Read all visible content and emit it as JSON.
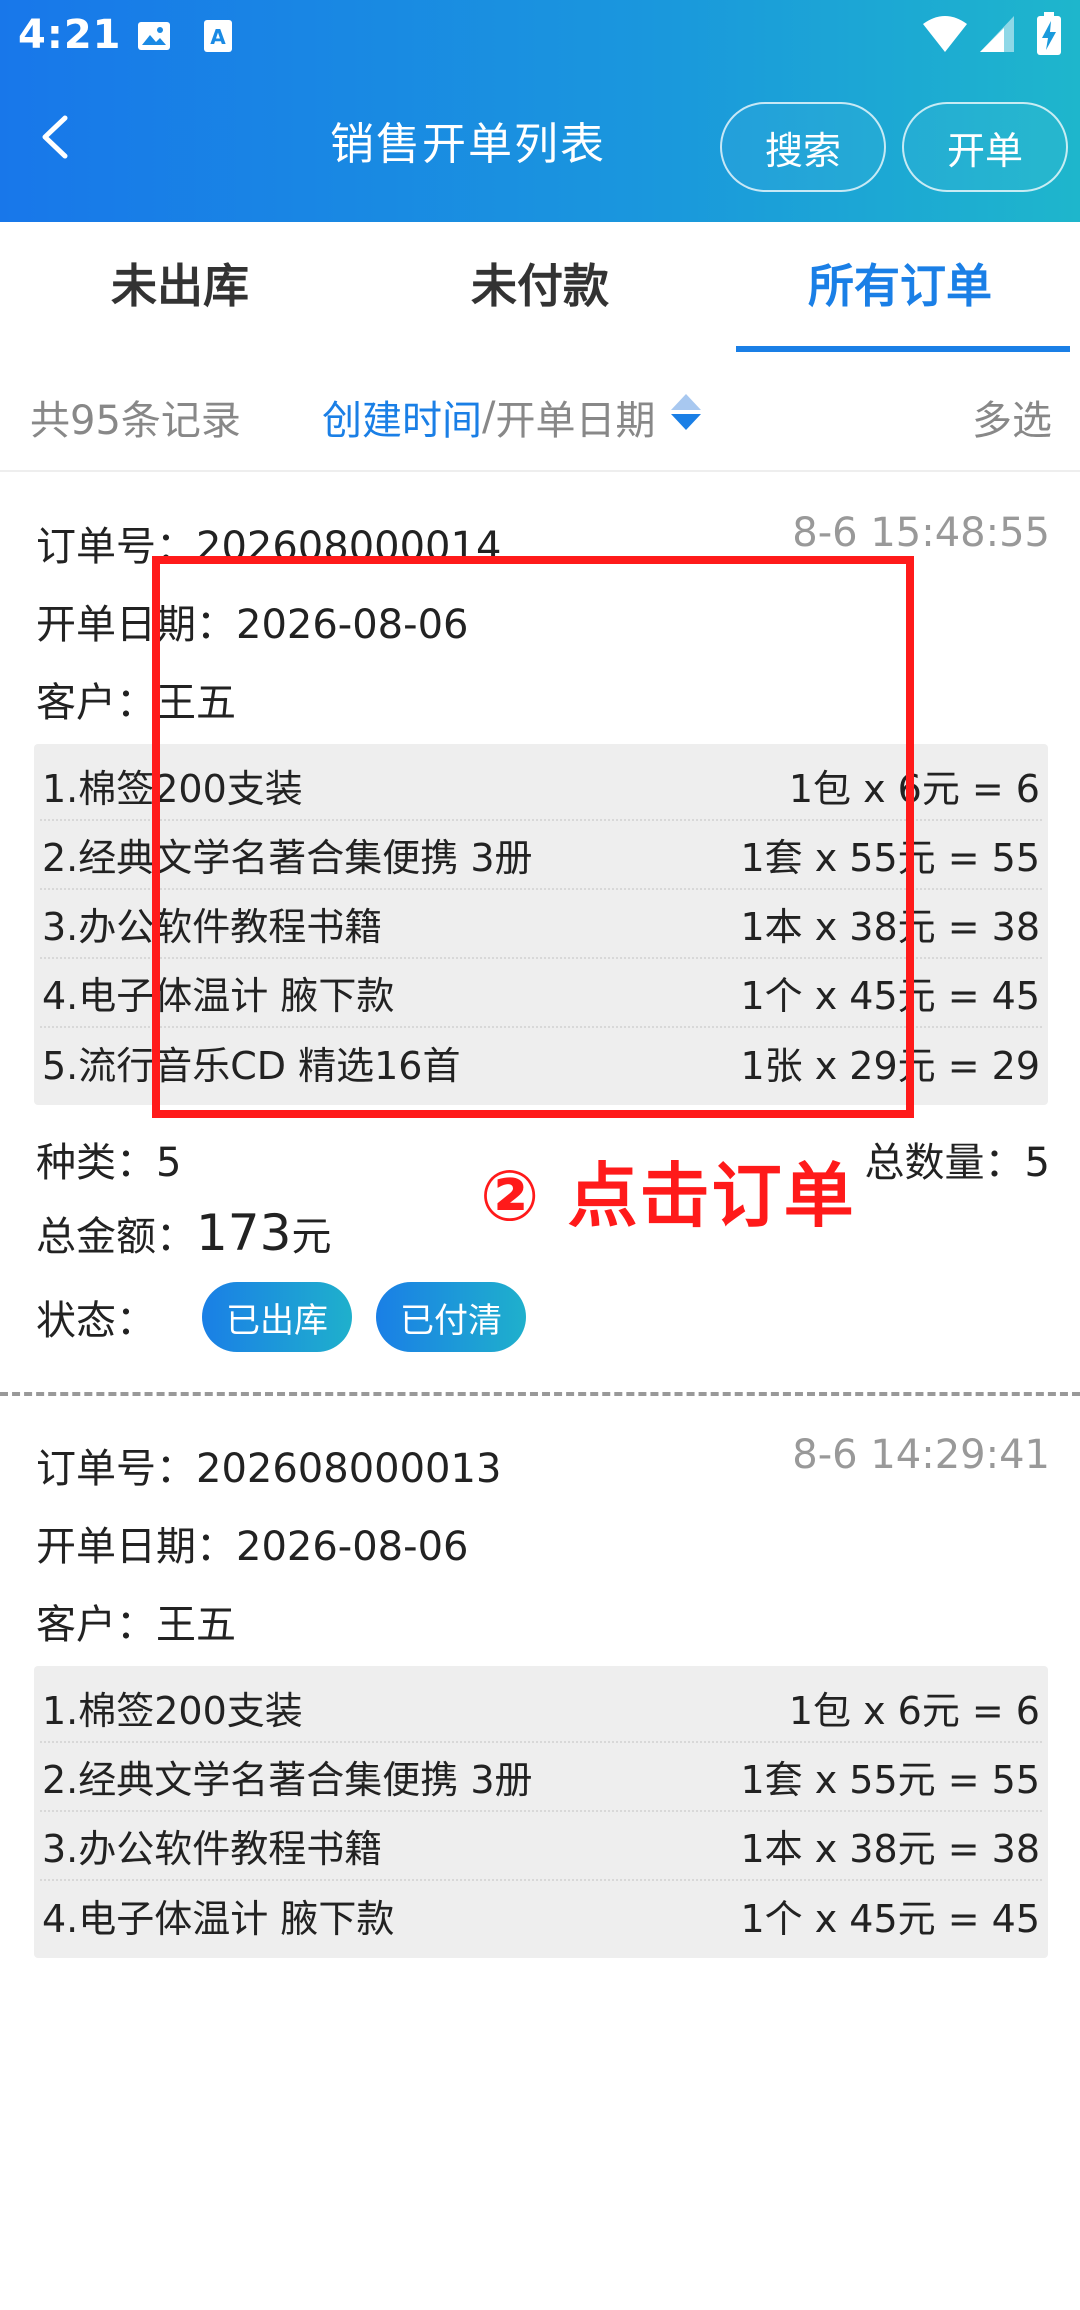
{
  "status_bar": {
    "time": "4:21"
  },
  "nav": {
    "title": "销售开单列表",
    "search_label": "搜索",
    "open_label": "开单"
  },
  "tabs": [
    {
      "label": "未出库",
      "active": false
    },
    {
      "label": "未付款",
      "active": false
    },
    {
      "label": "所有订单",
      "active": true
    }
  ],
  "filter": {
    "record_count": "共95条记录",
    "sort_active": "创建时间",
    "sort_separator": "/",
    "sort_inactive": "开单日期",
    "multi_select": "多选"
  },
  "orders": [
    {
      "order_no_label": "订单号：",
      "order_no": "202608000014",
      "time": "8-6 15:48:55",
      "open_date_label": "开单日期：",
      "open_date": "2026-08-06",
      "customer_label": "客户：",
      "customer": "王五",
      "items": [
        {
          "name": "1.棉签200支装",
          "price": "1包 x 6元 = 6"
        },
        {
          "name": "2.经典文学名著合集便携 3册",
          "price": "1套 x 55元 = 55"
        },
        {
          "name": "3.办公软件教程书籍",
          "price": "1本 x 38元 = 38"
        },
        {
          "name": "4.电子体温计 腋下款",
          "price": "1个 x 45元 = 45"
        },
        {
          "name": "5.流行音乐CD 精选16首",
          "price": "1张 x 29元 = 29"
        }
      ],
      "kinds_label": "种类：",
      "kinds": "5",
      "total_qty_label": "总数量：",
      "total_qty": "5",
      "total_amt_label": "总金额：",
      "total_amt": "173",
      "total_amt_unit": "元",
      "status_label": "状态：",
      "badges": [
        "已出库",
        "已付清"
      ]
    },
    {
      "order_no_label": "订单号：",
      "order_no": "202608000013",
      "time": "8-6 14:29:41",
      "open_date_label": "开单日期：",
      "open_date": "2026-08-06",
      "customer_label": "客户：",
      "customer": "王五",
      "items": [
        {
          "name": "1.棉签200支装",
          "price": "1包 x 6元 = 6"
        },
        {
          "name": "2.经典文学名著合集便携 3册",
          "price": "1套 x 55元 = 55"
        },
        {
          "name": "3.办公软件教程书籍",
          "price": "1本 x 38元 = 38"
        },
        {
          "name": "4.电子体温计 腋下款",
          "price": "1个 x 45元 = 45"
        }
      ]
    }
  ],
  "annotation": {
    "label": "② 点击订单",
    "color": "#ff1a1a"
  },
  "colors": {
    "accent": "#1a7fe6",
    "header_gradient_start": "#1877ea",
    "header_gradient_end": "#1eb6cc"
  }
}
